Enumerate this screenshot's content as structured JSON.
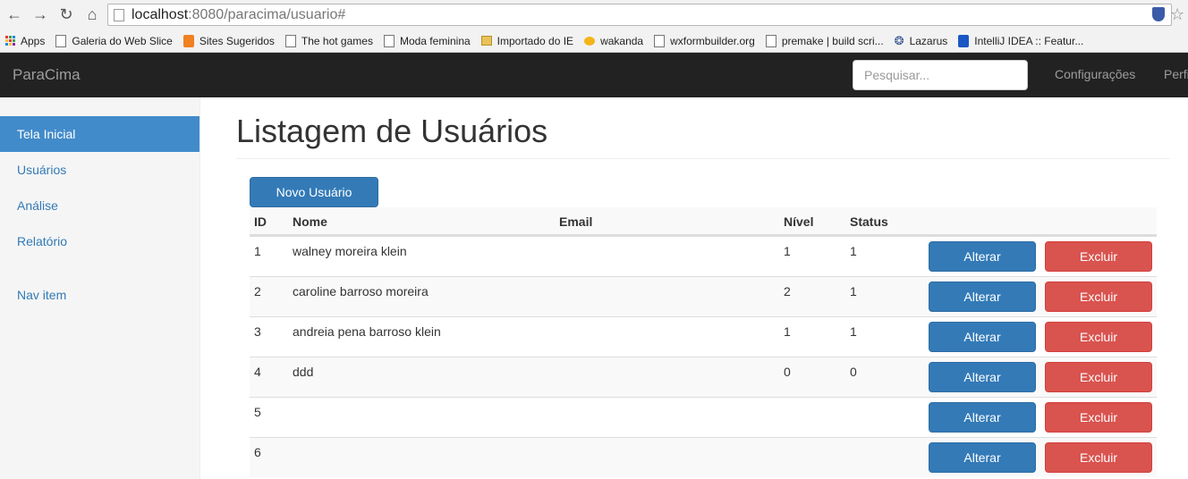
{
  "browser": {
    "url_host": "localhost",
    "url_path": ":8080/paracima/usuario#",
    "bookmarks": [
      {
        "label": "Apps",
        "icon": "apps-grid-icon"
      },
      {
        "label": "Galeria do Web Slice",
        "icon": "page-icon"
      },
      {
        "label": "Sites Sugeridos",
        "icon": "sites-icon"
      },
      {
        "label": "The hot games",
        "icon": "page-icon"
      },
      {
        "label": "Moda feminina",
        "icon": "page-icon"
      },
      {
        "label": "Importado do IE",
        "icon": "folder-icon"
      },
      {
        "label": "wakanda",
        "icon": "wakanda-icon"
      },
      {
        "label": "wxformbuilder.org",
        "icon": "page-icon"
      },
      {
        "label": "premake | build scri...",
        "icon": "page-icon"
      },
      {
        "label": "Lazarus",
        "icon": "lazarus-icon"
      },
      {
        "label": "IntelliJ IDEA :: Featur...",
        "icon": "intellij-icon"
      }
    ]
  },
  "navbar": {
    "brand": "ParaCima",
    "search_placeholder": "Pesquisar...",
    "links": [
      "Configurações",
      "Perfil"
    ]
  },
  "sidebar": {
    "items": [
      {
        "label": "Tela Inicial",
        "active": true
      },
      {
        "label": "Usuários",
        "active": false
      },
      {
        "label": "Análise",
        "active": false
      },
      {
        "label": "Relatório",
        "active": false
      },
      {
        "label": "Nav item",
        "active": false
      }
    ]
  },
  "main": {
    "title": "Listagem de Usuários",
    "new_button": "Novo Usuário",
    "table": {
      "headers": [
        "ID",
        "Nome",
        "Email",
        "Nível",
        "Status"
      ],
      "rows": [
        {
          "id": "1",
          "nome": "walney moreira klein",
          "email": "",
          "nivel": "1",
          "status": "1"
        },
        {
          "id": "2",
          "nome": "caroline barroso moreira",
          "email": "",
          "nivel": "2",
          "status": "1"
        },
        {
          "id": "3",
          "nome": "andreia pena barroso klein",
          "email": "",
          "nivel": "1",
          "status": "1"
        },
        {
          "id": "4",
          "nome": "ddd",
          "email": "",
          "nivel": "0",
          "status": "0"
        },
        {
          "id": "5",
          "nome": "",
          "email": "",
          "nivel": "",
          "status": ""
        },
        {
          "id": "6",
          "nome": "",
          "email": "",
          "nivel": "",
          "status": ""
        }
      ],
      "edit_label": "Alterar",
      "delete_label": "Excluir"
    }
  },
  "colors": {
    "primary": "#337ab7",
    "danger": "#d9534f",
    "navbar": "#222222",
    "sidebar_active": "#428bca"
  }
}
